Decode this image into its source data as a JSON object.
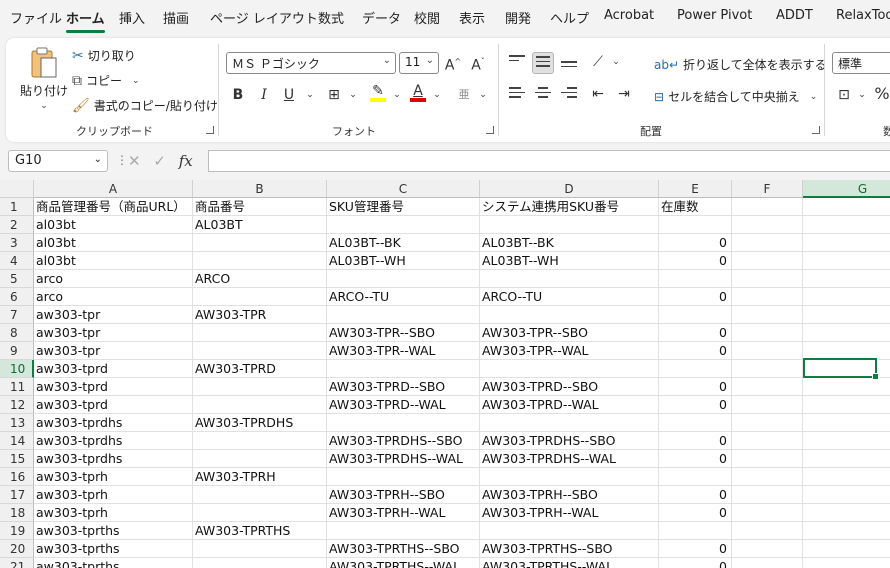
{
  "menu": {
    "tabs": [
      "ファイル",
      "ホーム",
      "挿入",
      "描画",
      "ページ レイアウト",
      "数式",
      "データ",
      "校閲",
      "表示",
      "開発",
      "ヘルプ",
      "Acrobat",
      "Power Pivot",
      "ADDT",
      "RelaxTools"
    ],
    "active_index": 1
  },
  "ribbon": {
    "clipboard": {
      "paste_label": "貼り付け",
      "cut_label": "切り取り",
      "copy_label": "コピー",
      "format_painter_label": "書式のコピー/貼り付け",
      "group_label": "クリップボード"
    },
    "font": {
      "font_name": "ＭＳ Ｐゴシック",
      "font_size": "11",
      "bold": "B",
      "italic": "I",
      "underline": "U",
      "group_label": "フォント",
      "highlight_color": "#ffff00",
      "font_color": "#e00000"
    },
    "alignment": {
      "wrap_text_label": "折り返して全体を表示する",
      "merge_center_label": "セルを結合して中央揃え",
      "group_label": "配置"
    },
    "number": {
      "format": "標準",
      "group_label_partial": "数"
    }
  },
  "formula_bar": {
    "name_box": "G10",
    "fx": "fx",
    "content": ""
  },
  "grid": {
    "columns": [
      "A",
      "B",
      "C",
      "D",
      "E",
      "F",
      "G"
    ],
    "selected_column": "G",
    "selected_row": "10",
    "rows": [
      {
        "n": "1",
        "a": "商品管理番号（商品URL）",
        "b": "商品番号",
        "c": "SKU管理番号",
        "d": "システム連携用SKU番号",
        "e": "在庫数"
      },
      {
        "n": "2",
        "a": "al03bt",
        "b": "AL03BT",
        "c": "",
        "d": "",
        "e": ""
      },
      {
        "n": "3",
        "a": "al03bt",
        "b": "",
        "c": "AL03BT--BK",
        "d": "AL03BT--BK",
        "e": "0"
      },
      {
        "n": "4",
        "a": "al03bt",
        "b": "",
        "c": "AL03BT--WH",
        "d": "AL03BT--WH",
        "e": "0"
      },
      {
        "n": "5",
        "a": "arco",
        "b": "ARCO",
        "c": "",
        "d": "",
        "e": ""
      },
      {
        "n": "6",
        "a": "arco",
        "b": "",
        "c": "ARCO--TU",
        "d": "ARCO--TU",
        "e": "0"
      },
      {
        "n": "7",
        "a": "aw303-tpr",
        "b": "AW303-TPR",
        "c": "",
        "d": "",
        "e": ""
      },
      {
        "n": "8",
        "a": "aw303-tpr",
        "b": "",
        "c": "AW303-TPR--SBO",
        "d": "AW303-TPR--SBO",
        "e": "0"
      },
      {
        "n": "9",
        "a": "aw303-tpr",
        "b": "",
        "c": "AW303-TPR--WAL",
        "d": "AW303-TPR--WAL",
        "e": "0"
      },
      {
        "n": "10",
        "a": "aw303-tprd",
        "b": "AW303-TPRD",
        "c": "",
        "d": "",
        "e": ""
      },
      {
        "n": "11",
        "a": "aw303-tprd",
        "b": "",
        "c": "AW303-TPRD--SBO",
        "d": "AW303-TPRD--SBO",
        "e": "0"
      },
      {
        "n": "12",
        "a": "aw303-tprd",
        "b": "",
        "c": "AW303-TPRD--WAL",
        "d": "AW303-TPRD--WAL",
        "e": "0"
      },
      {
        "n": "13",
        "a": "aw303-tprdhs",
        "b": "AW303-TPRDHS",
        "c": "",
        "d": "",
        "e": ""
      },
      {
        "n": "14",
        "a": "aw303-tprdhs",
        "b": "",
        "c": "AW303-TPRDHS--SBO",
        "d": "AW303-TPRDHS--SBO",
        "e": "0"
      },
      {
        "n": "15",
        "a": "aw303-tprdhs",
        "b": "",
        "c": "AW303-TPRDHS--WAL",
        "d": "AW303-TPRDHS--WAL",
        "e": "0"
      },
      {
        "n": "16",
        "a": "aw303-tprh",
        "b": "AW303-TPRH",
        "c": "",
        "d": "",
        "e": ""
      },
      {
        "n": "17",
        "a": "aw303-tprh",
        "b": "",
        "c": "AW303-TPRH--SBO",
        "d": "AW303-TPRH--SBO",
        "e": "0"
      },
      {
        "n": "18",
        "a": "aw303-tprh",
        "b": "",
        "c": "AW303-TPRH--WAL",
        "d": "AW303-TPRH--WAL",
        "e": "0"
      },
      {
        "n": "19",
        "a": "aw303-tprths",
        "b": "AW303-TPRTHS",
        "c": "",
        "d": "",
        "e": ""
      },
      {
        "n": "20",
        "a": "aw303-tprths",
        "b": "",
        "c": "AW303-TPRTHS--SBO",
        "d": "AW303-TPRTHS--SBO",
        "e": "0"
      },
      {
        "n": "21",
        "a": "aw303-tprths",
        "b": "",
        "c": "AW303-TPRTHS--WAL",
        "d": "AW303-TPRTHS--WAL",
        "e": "0"
      }
    ]
  }
}
